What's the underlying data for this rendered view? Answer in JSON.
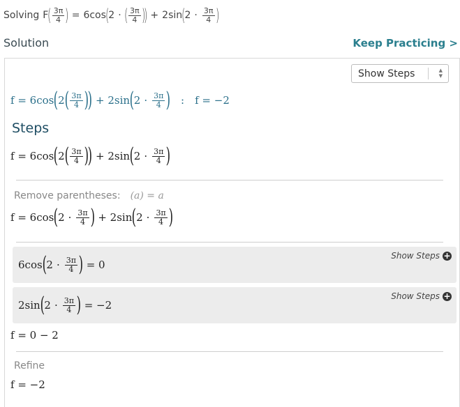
{
  "header": {
    "solving_prefix": "Solving",
    "f": "F",
    "num": "3π",
    "den": "4",
    "eq": "=",
    "cos_term": "6cos",
    "two": "2",
    "dot": "·",
    "plus": "+",
    "sin_term": "2sin"
  },
  "solution_label": "Solution",
  "keep_practicing": "Keep Practicing >",
  "show_steps_select": "Show Steps",
  "answer": {
    "lhs": "f = 6cos",
    "two": "2",
    "num": "3π",
    "den": "4",
    "plus_sin": "+ 2sin",
    "dot": "·",
    "colon": ":",
    "result": "f = −2"
  },
  "steps_heading": "Steps",
  "step1": {
    "lhs": "f = 6cos",
    "two": "2",
    "num": "3π",
    "den": "4",
    "plus_sin": "+ 2sin",
    "dot": "·"
  },
  "remove_parens": {
    "label": "Remove parentheses:",
    "rule": "(a) = a"
  },
  "step2": {
    "lhs": "f = 6cos",
    "two": "2",
    "dot": "·",
    "num": "3π",
    "den": "4",
    "plus_sin": "+ 2sin"
  },
  "substep1": {
    "term": "6cos",
    "two": "2",
    "dot": "·",
    "num": "3π",
    "den": "4",
    "result": "= 0",
    "show_steps": "Show Steps"
  },
  "substep2": {
    "term": "2sin",
    "two": "2",
    "dot": "·",
    "num": "3π",
    "den": "4",
    "result": "= −2",
    "show_steps": "Show Steps"
  },
  "step3": "f = 0 − 2",
  "refine_label": "Refine",
  "final": "f = −2"
}
